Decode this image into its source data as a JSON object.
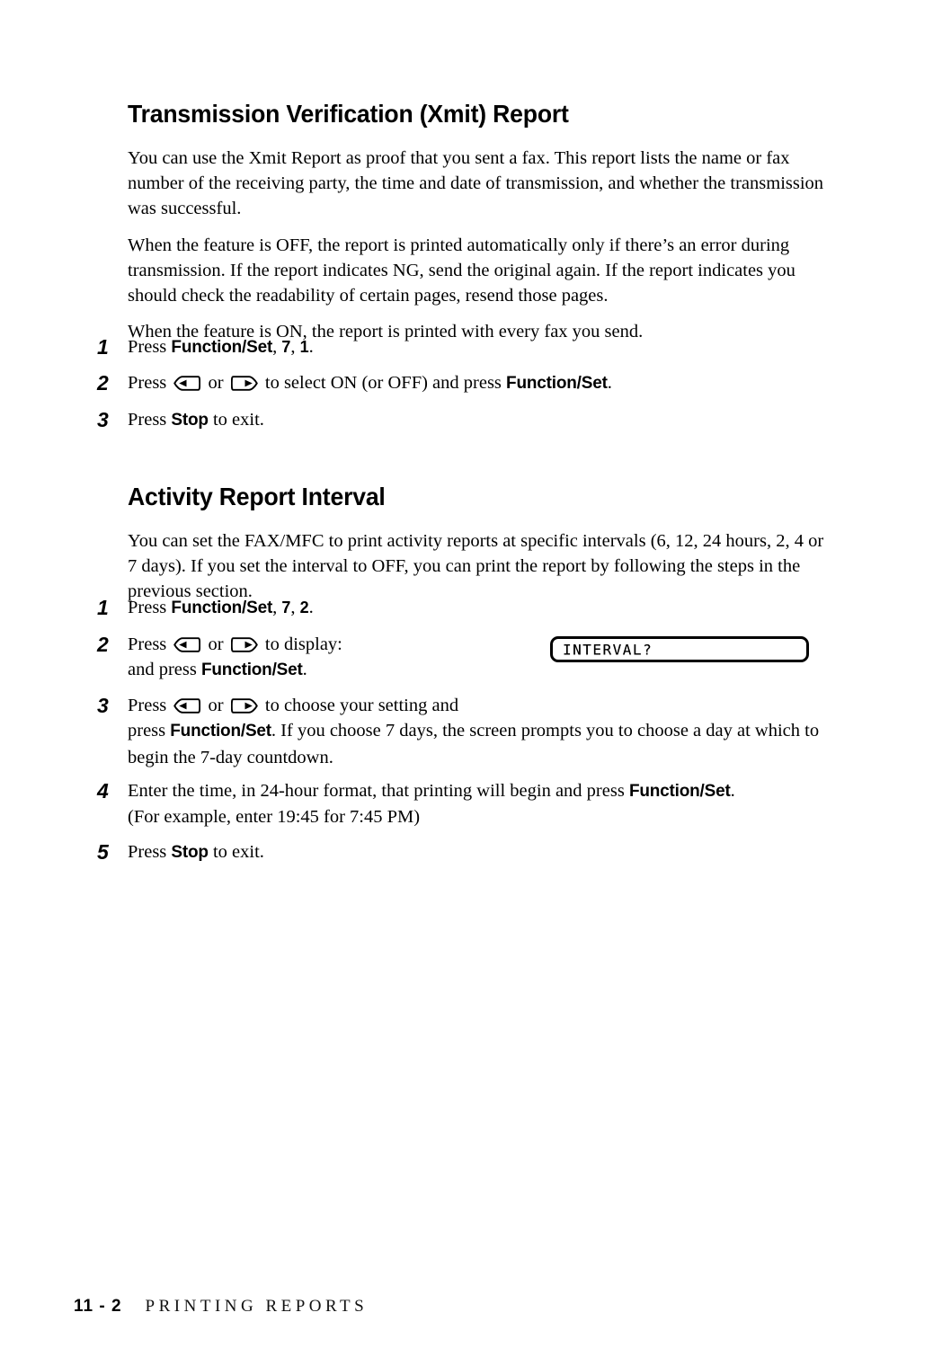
{
  "page": {
    "background_color": "#ffffff",
    "text_color": "#000000"
  },
  "sections": [
    {
      "heading": "Transmission Verification (Xmit) Report",
      "paragraphs": [
        "You can use the Xmit Report as proof that you sent a fax.  This report lists the name or fax number of the receiving party, the time and date of transmission, and whether the transmission was successful.",
        "When the feature is OFF, the report is printed automatically only if there’s an error during transmission.  If the report indicates NG, send the original again.  If the report indicates you should check the readability of certain pages, resend those pages.",
        "When the feature is ON, the report is printed with every fax you send."
      ],
      "steps": [
        {
          "number": "1",
          "pre": "Press ",
          "bold1": "Function/Set",
          "mid": ", ",
          "num1": "7",
          "mid2": ", ",
          "num2": "1",
          "post": "."
        },
        {
          "number": "2",
          "pre": "Press ",
          "mid": "  or  ",
          "post": "  to select ON (or OFF) and press ",
          "bold1": "Function/Set",
          "tail": "."
        },
        {
          "number": "3",
          "pre": "Press ",
          "bold1": "Stop",
          "post": " to exit."
        }
      ]
    },
    {
      "heading": "Activity Report Interval",
      "paragraphs": [
        "You can set the FAX/MFC to print activity reports at specific intervals (6, 12, 24 hours, 2, 4 or 7 days).  If you set the interval to OFF, you can print the report by following the steps in the previous section."
      ],
      "steps": [
        {
          "number": "1",
          "pre": "Press ",
          "bold1": "Function/Set",
          "mid": ", ",
          "num1": "7",
          "mid2": ", ",
          "num2": "2",
          "post": "."
        },
        {
          "number": "2",
          "pre": "Press ",
          "mid": " or ",
          "post": " to display:",
          "line2_pre": "and press ",
          "line2_bold": "Function/Set",
          "line2_post": "."
        },
        {
          "number": "3",
          "pre": "Press ",
          "mid": " or ",
          "post": " to choose your setting and",
          "line2_pre": "press ",
          "line2_bold": "Function/Set",
          "line2_post": ".  If you choose 7 days, the screen prompts you to choose a day at which to begin the 7-day countdown."
        },
        {
          "number": "4",
          "pre": "Enter the time, in 24-hour format, that printing will begin and press ",
          "bold1": "Function/Set",
          "post": ".",
          "line2": "(For example, enter 19:45 for 7:45 PM)"
        },
        {
          "number": "5",
          "pre": "Press ",
          "bold1": "Stop",
          "post": " to exit."
        }
      ]
    }
  ],
  "lcd_display": {
    "text": "INTERVAL?"
  },
  "icons": {
    "left_arrow_key": "left-arrow-key-icon",
    "right_arrow_key": "right-arrow-key-icon"
  },
  "footer": {
    "page_number": "11 - 2",
    "title": "PRINTING REPORTS"
  }
}
